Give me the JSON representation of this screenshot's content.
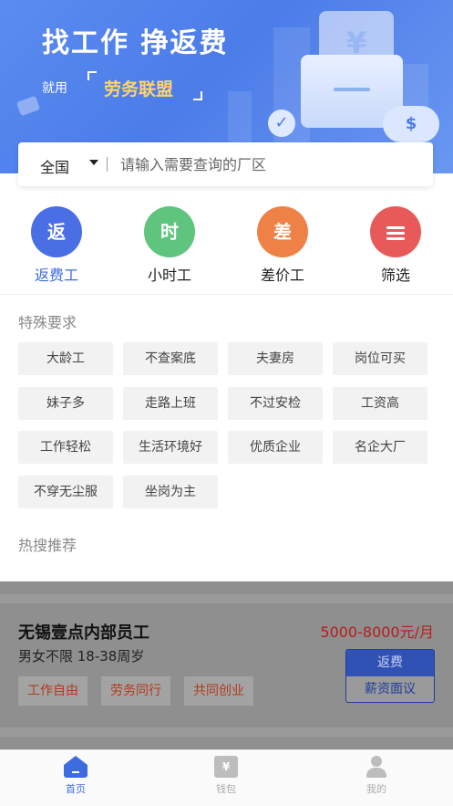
{
  "banner": {
    "title": "找工作 挣返费",
    "subtitle_prefix": "就用",
    "brand": "劳务联盟",
    "wallet_symbol": "¥",
    "piggy_symbol": "$",
    "check_symbol": "✓"
  },
  "search": {
    "region": "全国",
    "placeholder": "请输入需要查询的厂区"
  },
  "categories": [
    {
      "icon_text": "返",
      "label": "返费工",
      "color": "#4a6ee3"
    },
    {
      "icon_text": "时",
      "label": "小时工",
      "color": "#5ec47e"
    },
    {
      "icon_text": "差",
      "label": "差价工",
      "color": "#ee8246"
    },
    {
      "icon_text": "",
      "label": "筛选",
      "color": "#e85a5a"
    }
  ],
  "special": {
    "title": "特殊要求",
    "tags": [
      "大龄工",
      "不查案底",
      "夫妻房",
      "岗位可买",
      "妹子多",
      "走路上班",
      "不过安检",
      "工资高",
      "工作轻松",
      "生活环境好",
      "优质企业",
      "名企大厂",
      "不穿无尘服",
      "坐岗为主"
    ]
  },
  "hot": {
    "title": "热搜推荐"
  },
  "job": {
    "title": "无锡壹点内部员工",
    "salary": "5000-8000元/月",
    "requirements": "男女不限 18-38周岁",
    "tags": [
      "工作自由",
      "劳务同行",
      "共同创业"
    ],
    "fee_label": "返费",
    "salary_label": "薪资面议"
  },
  "nav": {
    "home": "首页",
    "wallet": "钱包",
    "wallet_symbol": "¥",
    "mine": "我的"
  }
}
